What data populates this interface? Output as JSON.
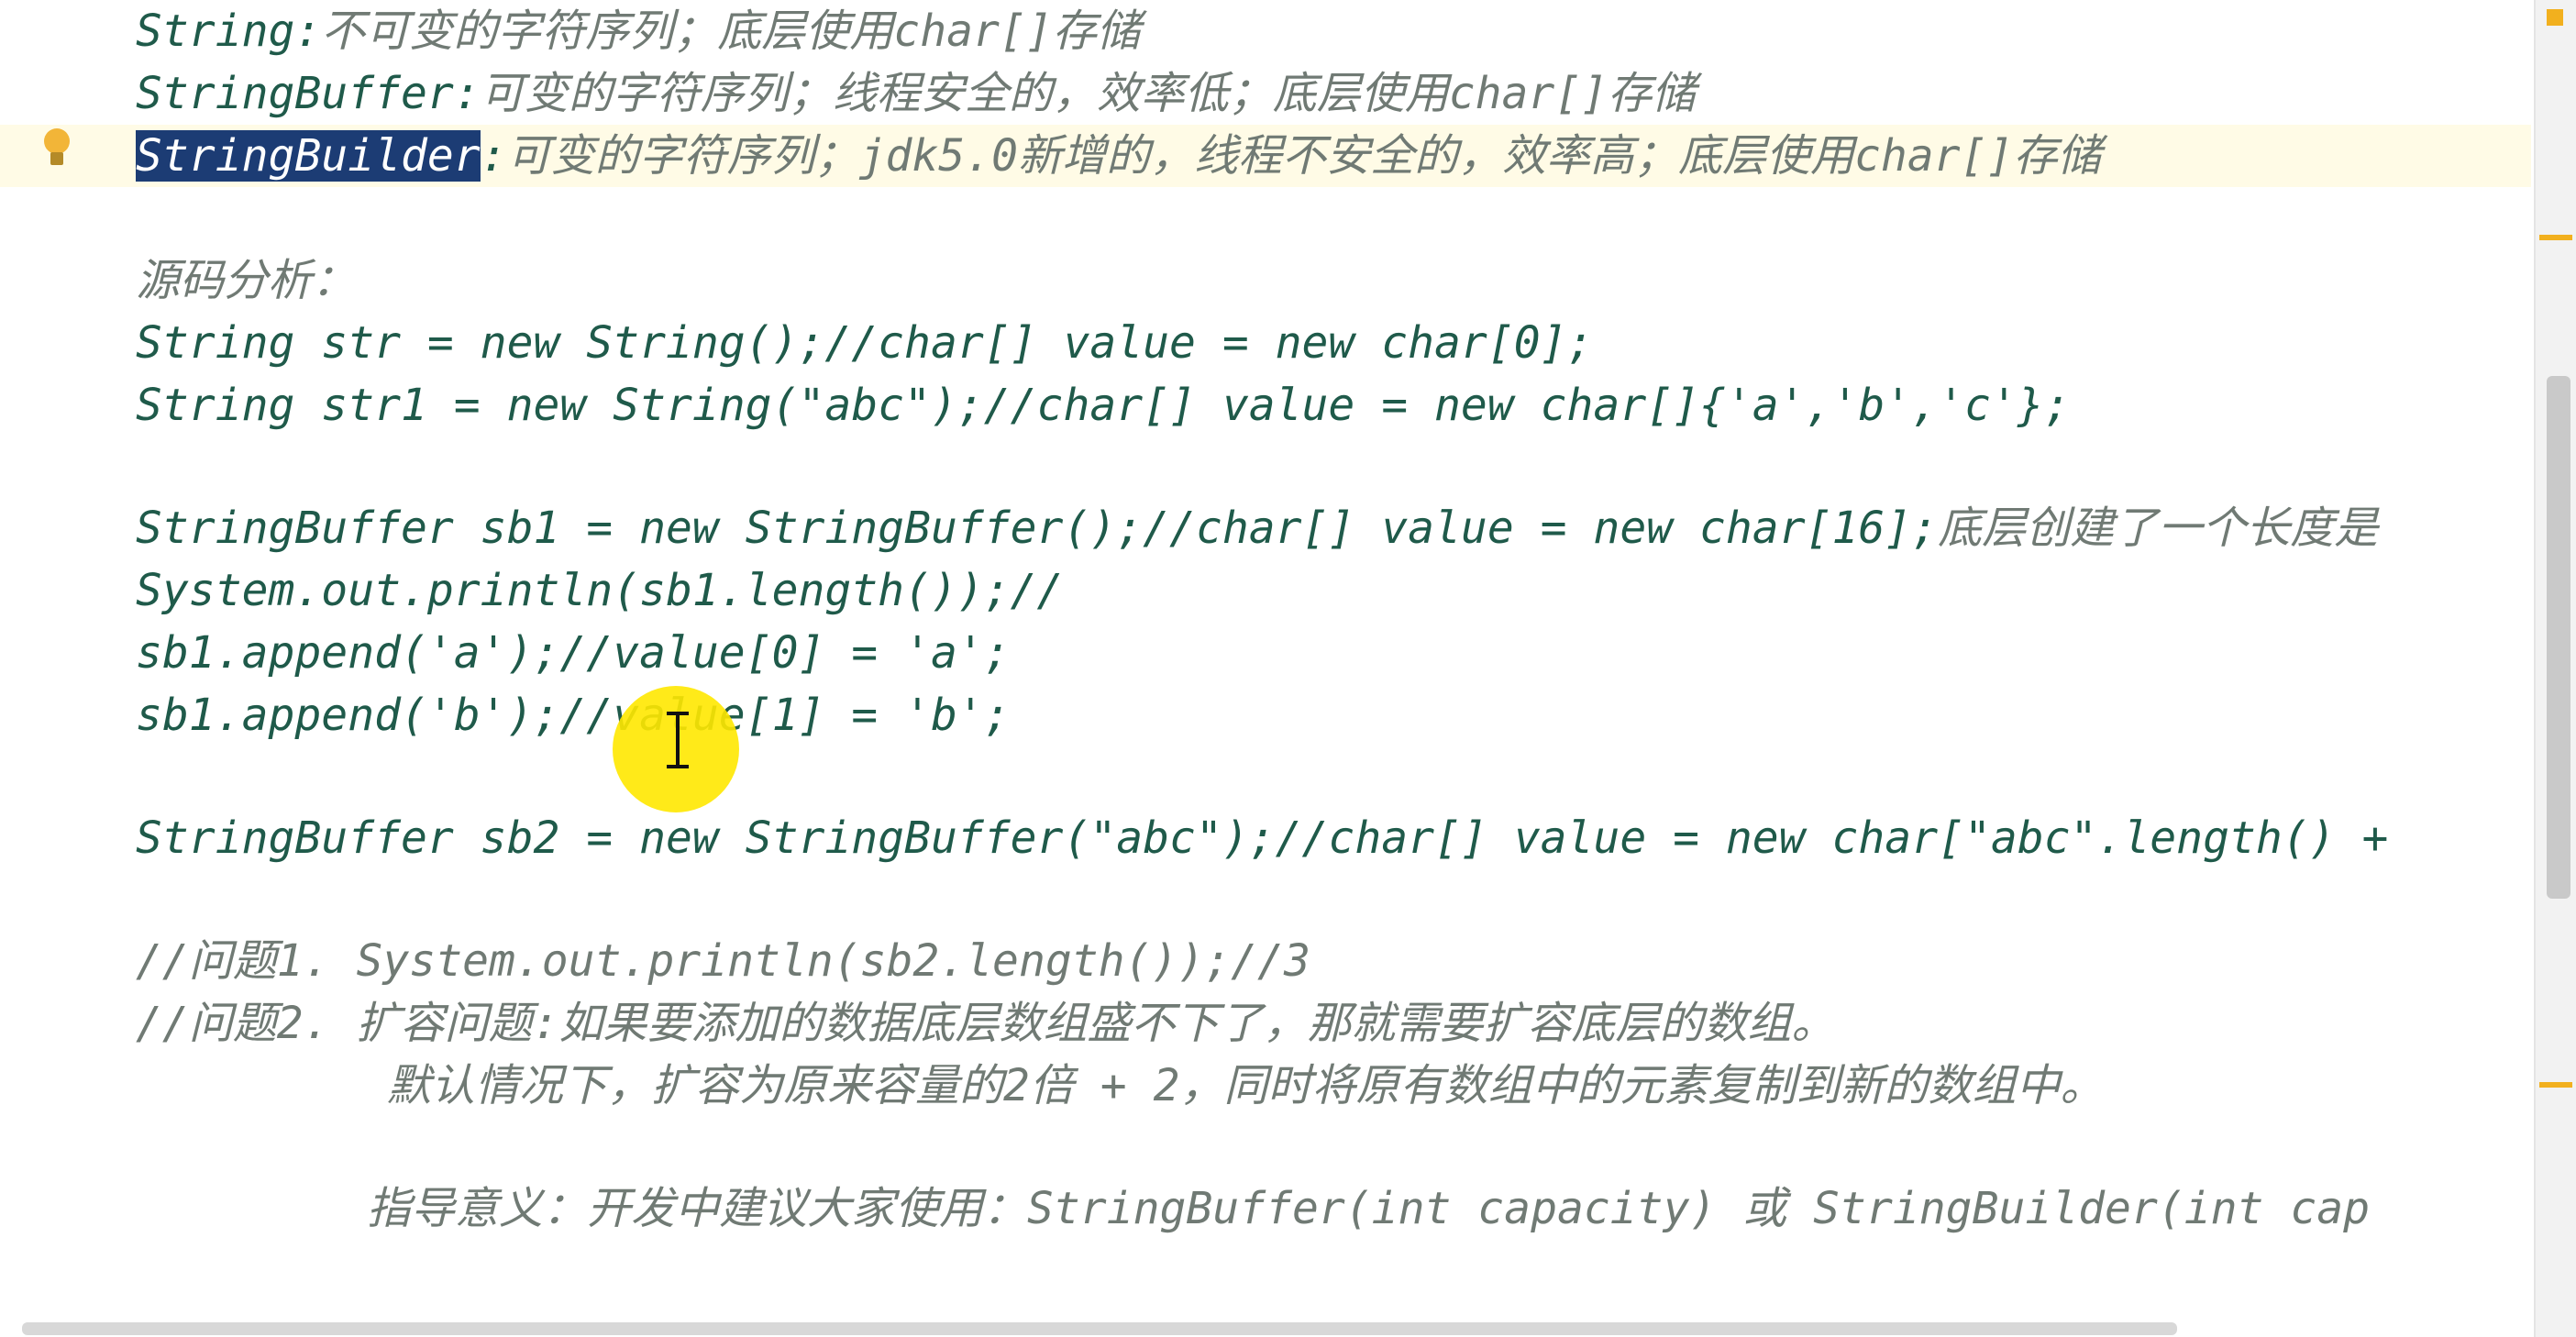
{
  "editor": {
    "lines": [
      {
        "code": "String:",
        "comment": "不可变的字符序列；底层使用char[]存储"
      },
      {
        "code": "StringBuffer:",
        "comment": "可变的字符序列；线程安全的，效率低；底层使用char[]存储"
      },
      {
        "selected": "StringBuilder",
        "code": ":",
        "comment": "可变的字符序列；jdk5.0新增的，线程不安全的，效率高；底层使用char[]存储"
      },
      {
        "comment": "源码分析："
      },
      {
        "code": "String str = new String();//char[] value = new char[0];"
      },
      {
        "code": "String str1 = new String(\"abc\");//char[] value = new char[]{'a','b','c'};"
      },
      {
        "code": "StringBuffer sb1 = new StringBuffer();//char[] value = new char[16];",
        "comment": "底层创建了一个长度是"
      },
      {
        "code": "System.out.println(sb1.length());//"
      },
      {
        "code": "sb1.append('a');//value[0] = 'a';"
      },
      {
        "code": "sb1.append('b');//value[1] = 'b';"
      },
      {
        "code": "StringBuffer sb2 = new StringBuffer(\"abc\");//char[] value = new char[\"abc\".length() +"
      },
      {
        "comment": "//问题1. System.out.println(sb2.length());//3"
      },
      {
        "comment": "//问题2. 扩容问题:如果要添加的数据底层数组盛不下了，那就需要扩容底层的数组。"
      },
      {
        "comment": "默认情况下，扩容为原来容量的2倍 + 2，同时将原有数组中的元素复制到新的数组中。"
      },
      {
        "comment": "指导意义：开发中建议大家使用：StringBuffer(int capacity) 或 StringBuilder(int cap"
      }
    ]
  },
  "icons": {
    "gutter_intention": "lightbulb-icon",
    "mouse_cursor": "text-cursor-icon"
  },
  "colors": {
    "code_text": "#1f5a4a",
    "comment_text": "#707a74",
    "selection_bg": "#1c3c74",
    "caret_row_bg": "#fffbe6",
    "marker": "#f2b01e"
  }
}
